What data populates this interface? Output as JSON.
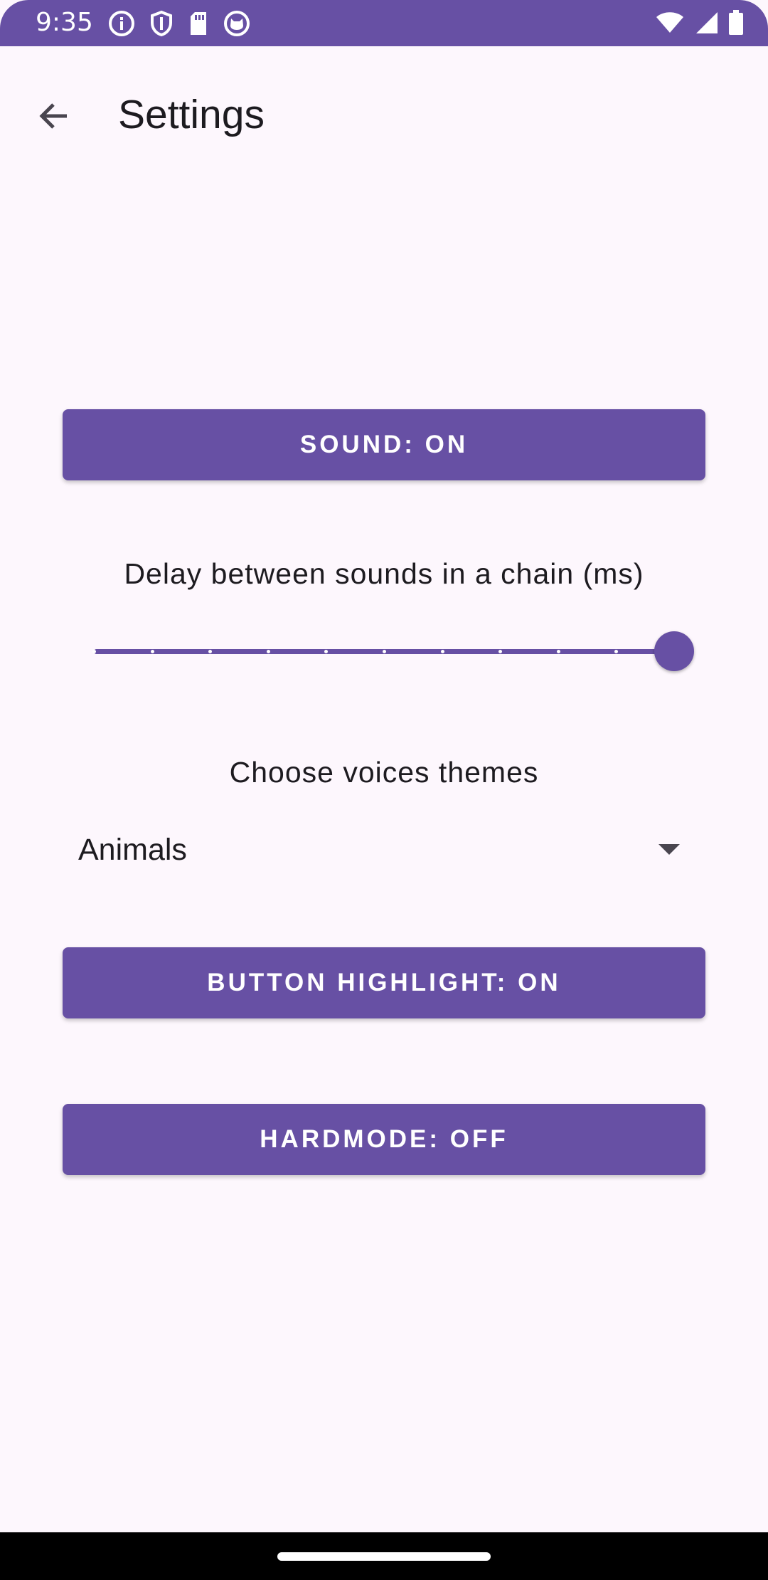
{
  "status_bar": {
    "time": "9:35",
    "left_icons": [
      "info-icon",
      "shield-icon",
      "sd-card-icon",
      "cat-icon"
    ],
    "right_icons": [
      "wifi-icon",
      "signal-icon",
      "battery-icon"
    ],
    "background": "#6750a4"
  },
  "app_bar": {
    "title": "Settings",
    "back_icon": "arrow-back-icon"
  },
  "settings": {
    "sound_button_label": "SOUND: ON",
    "delay_label": "Delay between sounds in a chain (ms)",
    "delay_slider": {
      "steps": 10,
      "value_fraction": 1.0
    },
    "voices_label": "Choose voices themes",
    "voices_dropdown": {
      "selected": "Animals"
    },
    "highlight_button_label": "BUTTON HIGHLIGHT: ON",
    "hardmode_button_label": "HARDMODE: OFF"
  },
  "colors": {
    "primary": "#6750a4",
    "background": "#fdf7fd",
    "on_surface": "#1d1b20"
  }
}
